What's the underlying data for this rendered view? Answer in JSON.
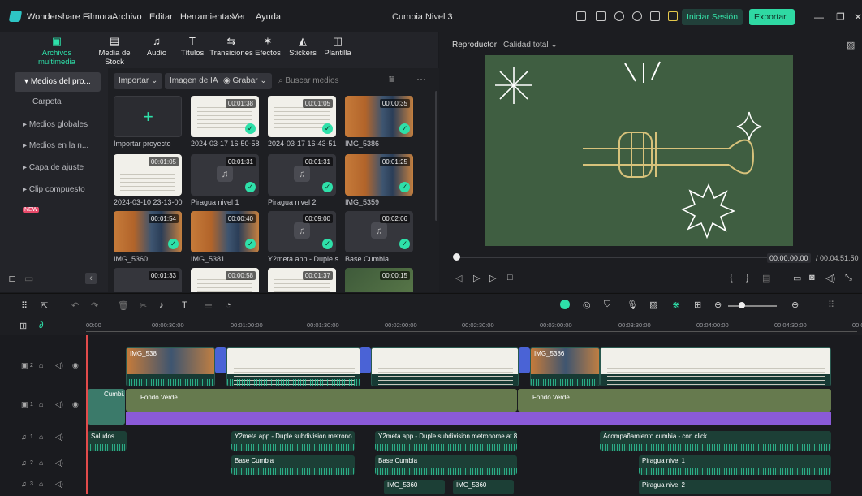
{
  "titlebar": {
    "app_name": "Wondershare Filmora",
    "menus": [
      "Archivo",
      "Editar",
      "Herramientas",
      "Ver",
      "Ayuda"
    ],
    "project_name": "Cumbia Nivel 3",
    "login_label": "Iniciar Sesión",
    "export_label": "Exportar"
  },
  "media_tabs": [
    {
      "label": "Archivos multimedia",
      "icon": "folder-icon",
      "active": true
    },
    {
      "label": "Media de Stock",
      "icon": "stock-icon"
    },
    {
      "label": "Audio",
      "icon": "music-note-icon"
    },
    {
      "label": "Títulos",
      "icon": "text-icon"
    },
    {
      "label": "Transiciones",
      "icon": "transition-icon"
    },
    {
      "label": "Efectos",
      "icon": "effects-icon"
    },
    {
      "label": "Stickers",
      "icon": "sticker-icon"
    },
    {
      "label": "Plantilla",
      "icon": "template-icon"
    }
  ],
  "sidebar": {
    "items": [
      {
        "label": "Medios del pro..."
      },
      {
        "label": "Carpeta"
      },
      {
        "label": "Medios globales"
      },
      {
        "label": "Medios en la n..."
      },
      {
        "label": "Capa de ajuste"
      },
      {
        "label": "Clip compuesto",
        "badge": "NEW"
      }
    ]
  },
  "media_toolbar": {
    "import_label": "Importar",
    "ai_image_label": "Imagen de IA",
    "record_label": "Grabar",
    "search_placeholder": "Buscar medios"
  },
  "media_items": [
    {
      "label": "Importar proyecto",
      "type": "add"
    },
    {
      "label": "2024-03-17 16-50-58",
      "duration": "00:01:38",
      "type": "sheet"
    },
    {
      "label": "2024-03-17 16-43-51",
      "duration": "00:01:05",
      "type": "sheet"
    },
    {
      "label": "IMG_5386",
      "duration": "00:00:35",
      "type": "photo"
    },
    {
      "label": "2024-03-10 23-13-00",
      "duration": "00:01:05",
      "type": "sheet"
    },
    {
      "label": "Piragua nivel 1",
      "duration": "00:01:31",
      "type": "audio"
    },
    {
      "label": "Piragua nivel 2",
      "duration": "00:01:31",
      "type": "audio"
    },
    {
      "label": "IMG_5359",
      "duration": "00:01:25",
      "type": "photo"
    },
    {
      "label": "IMG_5360",
      "duration": "00:01:54",
      "type": "photo"
    },
    {
      "label": "IMG_5381",
      "duration": "00:00:40",
      "type": "photo"
    },
    {
      "label": "Y2meta.app - Duple s...",
      "duration": "00:09:00",
      "type": "audio"
    },
    {
      "label": "Base Cumbia",
      "duration": "00:02:06",
      "type": "audio"
    },
    {
      "label": "",
      "duration": "00:01:33",
      "type": "audio"
    },
    {
      "label": "",
      "duration": "00:00:58",
      "type": "sheet"
    },
    {
      "label": "",
      "duration": "00:01:37",
      "type": "sheet"
    },
    {
      "label": "",
      "duration": "00:00:15",
      "type": "green"
    }
  ],
  "player": {
    "tab_label": "Reproductor",
    "quality_label": "Calidad total",
    "current_time": "00:00:00:00",
    "total_time": "/ 00:04:51:50"
  },
  "timeline": {
    "ruler_ticks": [
      "00:00",
      "00:00:30:00",
      "00:01:00:00",
      "00:01:30:00",
      "00:02:00:00",
      "00:02:30:00",
      "00:03:00:00",
      "00:03:30:00",
      "00:04:00:00",
      "00:04:30:00",
      "00:0"
    ],
    "clips": {
      "v2_a": "IMG_538",
      "v2_b": "IMG_5386",
      "v1_a": "Cumbi...",
      "v1_b": "Fondo Verde",
      "v1_c": "Fondo Verde",
      "a1_a": "Saludos",
      "a1_b": "Y2meta.app - Duple subdivision metrono...",
      "a1_c": "Y2meta.app - Duple subdivision metronome at 8...",
      "a1_d": "Acompañamiento cumbia - con click",
      "a2_a": "Base Cumbia",
      "a2_b": "Base Cumbia",
      "a2_c": "Piragua nivel 1",
      "a3_a": "IMG_5360",
      "a3_b": "IMG_5360",
      "a3_c": "Piragua nivel 2"
    },
    "track_numbers": [
      "2",
      "1",
      "1",
      "2",
      "3"
    ]
  }
}
